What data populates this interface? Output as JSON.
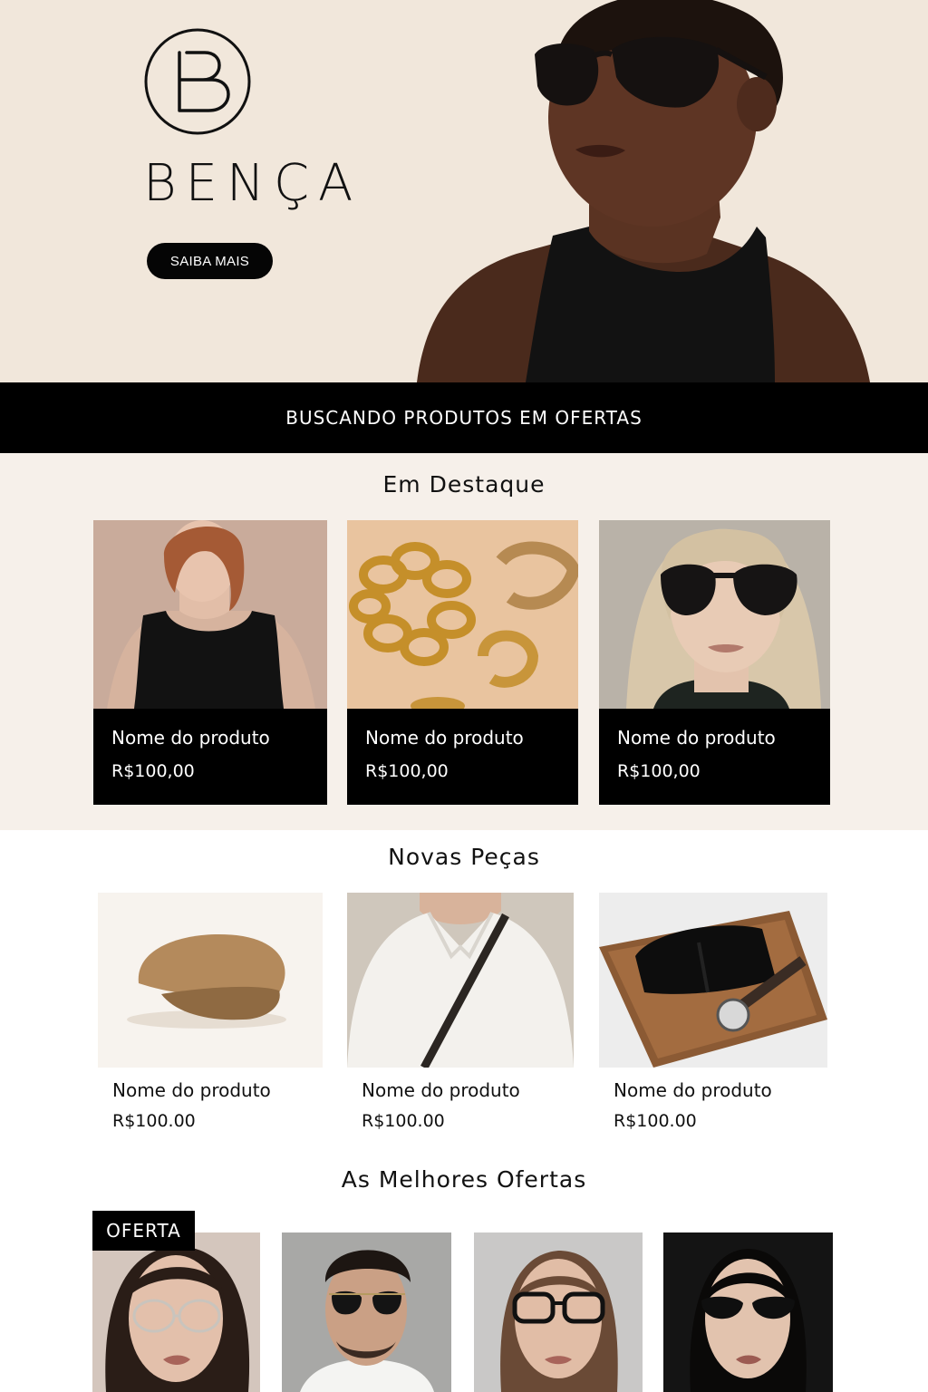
{
  "brand": {
    "logo_letter": "B",
    "name": "BENÇA"
  },
  "hero": {
    "cta_label": "SAIBA MAIS"
  },
  "banner": {
    "text": "BUSCANDO PRODUTOS EM OFERTAS"
  },
  "featured": {
    "title": "Em Destaque",
    "products": [
      {
        "name": "Nome do produto",
        "price": "R$100,00",
        "image": "woman-black-tank-top"
      },
      {
        "name": "Nome do produto",
        "price": "R$100,00",
        "image": "gold-jewelry"
      },
      {
        "name": "Nome do produto",
        "price": "R$100,00",
        "image": "woman-black-sunglasses"
      }
    ]
  },
  "new_items": {
    "title": "Novas Peças",
    "products": [
      {
        "name": "Nome do produto",
        "price": "R$100.00",
        "image": "tan-wool-cap"
      },
      {
        "name": "Nome do produto",
        "price": "R$100.00",
        "image": "white-shirt-crossbody-strap"
      },
      {
        "name": "Nome do produto",
        "price": "R$100.00",
        "image": "folded-black-knit-and-watch"
      }
    ]
  },
  "offers": {
    "title": "As Melhores Ofertas",
    "badge": "OFERTA",
    "products": [
      {
        "image": "woman-clear-glasses"
      },
      {
        "image": "man-aviator-sunglasses"
      },
      {
        "image": "woman-black-frame-glasses"
      },
      {
        "image": "woman-cat-eye-sunglasses"
      }
    ]
  },
  "colors": {
    "hero_bg": "#f1e7db",
    "accent": "#000000",
    "featured_bg": "#f6f0ea"
  }
}
